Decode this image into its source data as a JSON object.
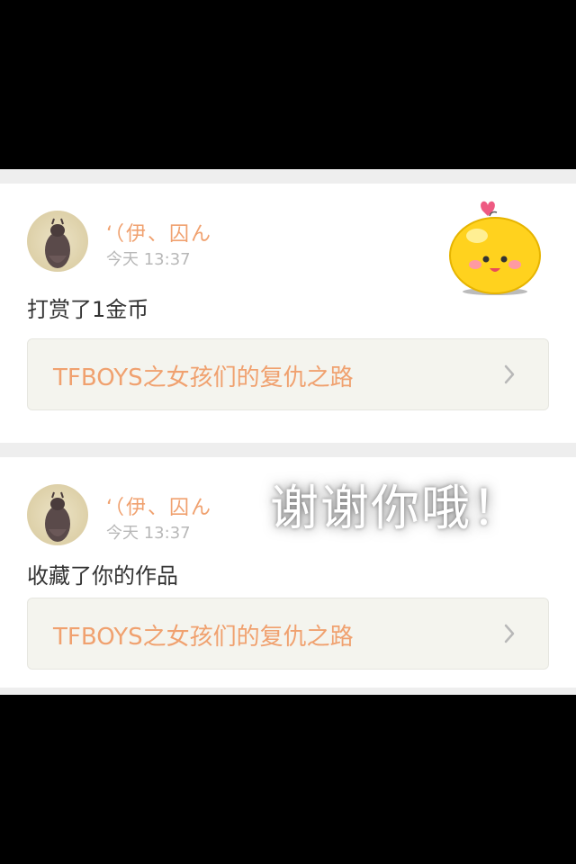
{
  "notifications": [
    {
      "username": "‘（伊、囚ん",
      "time": "今天 13:37",
      "action": "打赏了1金币",
      "work_title": "TFBOYS之女孩们的复仇之路"
    },
    {
      "username": "‘（伊、囚ん",
      "time": "今天 13:37",
      "action": "收藏了你的作品",
      "work_title": "TFBOYS之女孩们的复仇之路"
    }
  ],
  "overlay": {
    "thanks_text": "谢谢你哦！"
  },
  "icons": {
    "chevron": "chevron-right-icon",
    "sticker": "yellow-blob-sticker"
  },
  "colors": {
    "accent": "#f0a16f",
    "background": "#000000",
    "card": "#ffffff",
    "link_box": "#f4f4ee"
  }
}
